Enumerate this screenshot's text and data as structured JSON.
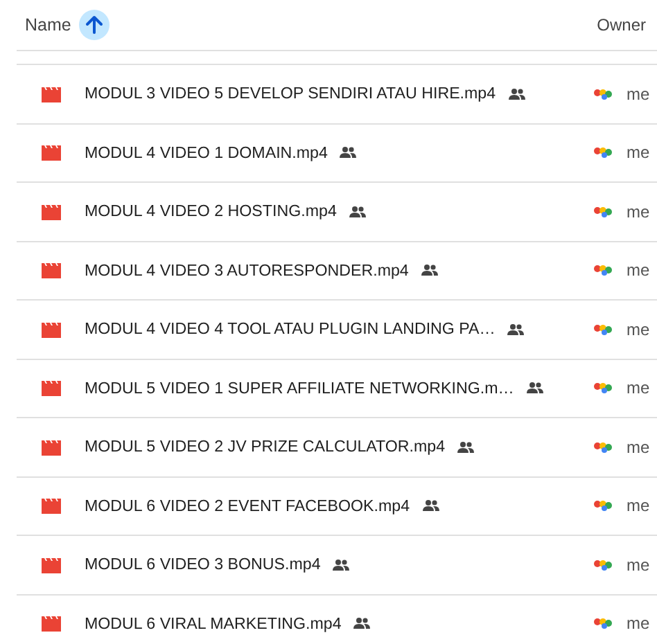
{
  "header": {
    "name_label": "Name",
    "sort_ascending": true,
    "owner_label": "Owner"
  },
  "files": [
    {
      "name": "MODUL 3 VIDEO 5 DEVELOP SENDIRI ATAU HIRE.mp4",
      "shared": true,
      "owner": "me"
    },
    {
      "name": "MODUL 4 VIDEO 1 DOMAIN.mp4",
      "shared": true,
      "owner": "me"
    },
    {
      "name": "MODUL 4 VIDEO 2 HOSTING.mp4",
      "shared": true,
      "owner": "me"
    },
    {
      "name": "MODUL 4 VIDEO 3 AUTORESPONDER.mp4",
      "shared": true,
      "owner": "me"
    },
    {
      "name": "MODUL 4 VIDEO 4 TOOL ATAU PLUGIN LANDING PA…",
      "shared": true,
      "owner": "me"
    },
    {
      "name": "MODUL 5 VIDEO 1 SUPER AFFILIATE NETWORKING.m…",
      "shared": true,
      "owner": "me"
    },
    {
      "name": "MODUL 5 VIDEO 2 JV PRIZE CALCULATOR.mp4",
      "shared": true,
      "owner": "me"
    },
    {
      "name": "MODUL 6 VIDEO 2 EVENT FACEBOOK.mp4",
      "shared": true,
      "owner": "me"
    },
    {
      "name": "MODUL 6 VIDEO 3 BONUS.mp4",
      "shared": true,
      "owner": "me"
    },
    {
      "name": "MODUL 6 VIRAL MARKETING.mp4",
      "shared": true,
      "owner": "me"
    }
  ]
}
